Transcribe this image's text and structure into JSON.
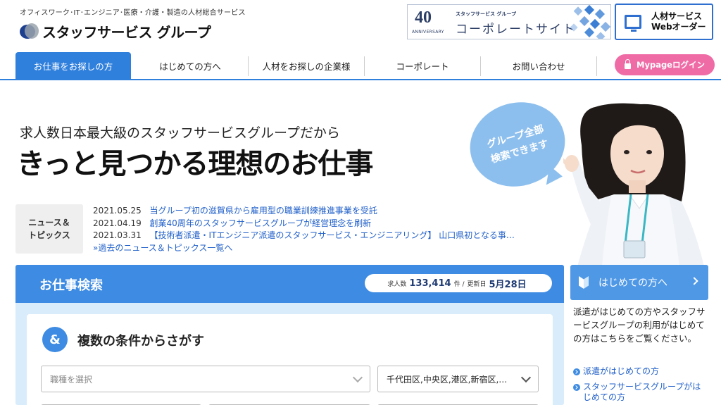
{
  "header": {
    "tagline": "オフィスワーク･IT･エンジニア･医療・介護・製造の人材総合サービス",
    "logo_text": "スタッフサービス グループ",
    "corporate_banner": {
      "number": "40",
      "anniversary": "ANNIVERSARY",
      "brand": "スタッフサービス グループ",
      "title": "コーポレートサイト"
    },
    "web_order": {
      "line1": "人材サービス",
      "line2": "Webオーダー"
    }
  },
  "nav": {
    "items": [
      {
        "label": "お仕事をお探しの方",
        "active": true
      },
      {
        "label": "はじめての方へ",
        "active": false
      },
      {
        "label": "人材をお探しの企業様",
        "active": false
      },
      {
        "label": "コーポレート",
        "active": false
      },
      {
        "label": "お問い合わせ",
        "active": false
      }
    ],
    "mypage_label": "Mypageログイン"
  },
  "hero": {
    "subtitle": "求人数日本最大級のスタッフサービスグループだから",
    "title": "きっと見つかる理想のお仕事",
    "bubble_line1": "グループ全部",
    "bubble_line2": "検索できます"
  },
  "news": {
    "label_line1": "ニュース＆",
    "label_line2": "トピックス",
    "items": [
      {
        "date": "2021.05.25",
        "text": "当グループ初の滋賀県から雇用型の職業訓練推進事業を受託"
      },
      {
        "date": "2021.04.19",
        "text": "創業40周年のスタッフサービスグループが経営理念を刷新"
      },
      {
        "date": "2021.03.31",
        "text": "【技術者派遣・ITエンジニア派遣のスタッフサービス・エンジニアリング】 山口県初となる事…"
      }
    ],
    "more_link": "»過去のニュース＆トピックス一覧へ"
  },
  "search": {
    "title": "お仕事検索",
    "stats_count_label": "求人数",
    "stats_count": "133,414",
    "stats_count_unit": "件 /",
    "stats_updated_label": "更新日",
    "stats_updated": "5月28日",
    "multi_icon": "&",
    "multi_title": "複数の条件からさがす",
    "job_type_placeholder": "職種を選択",
    "area_value": "千代田区,中央区,港区,新宿区,…"
  },
  "side": {
    "button_label": "はじめての方へ",
    "description": "派遣がはじめての方やスタッフサービスグループの利用がはじめての方はこちらをご覧ください。",
    "links": [
      "派遣がはじめての方",
      "スタッフサービスグループがはじめての方"
    ]
  },
  "colors": {
    "primary": "#2f7fdc",
    "header_blue": "#3d8be2",
    "pink": "#ef6ba6",
    "light_blue": "#d8ecfb"
  }
}
